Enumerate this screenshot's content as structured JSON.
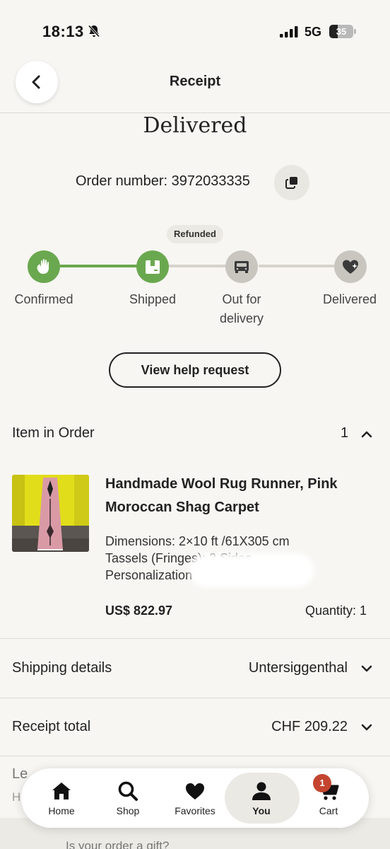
{
  "status_bar": {
    "time": "18:13",
    "network": "5G",
    "battery": "35",
    "battery_level": 0.35
  },
  "header": {
    "title": "Receipt",
    "back_icon": "chevron-left-icon"
  },
  "order": {
    "status_heading": "Delivered",
    "order_number_label": "Order number: 3972033335",
    "copy_icon": "copy-icon",
    "badge": "Refunded"
  },
  "tracker": {
    "steps": [
      {
        "label": "Confirmed",
        "icon": "hand-wave-icon",
        "done": true
      },
      {
        "label": "Shipped",
        "icon": "package-icon",
        "done": true
      },
      {
        "label": "Out for delivery",
        "icon": "truck-icon",
        "done": false
      },
      {
        "label": "Delivered",
        "icon": "heart-sparkle-icon",
        "done": false
      }
    ],
    "colors": {
      "done": "#6aa84f",
      "pending": "#d6d3cd",
      "pending_icon_bg": "#c9c6c0"
    }
  },
  "help_button": "View help request",
  "items_section": {
    "label": "Item in Order",
    "count": "1"
  },
  "product": {
    "title": "Handmade Wool Rug Runner, Pink Moroccan Shag Carpet",
    "dimensions": "Dimensions: 2×10 ft /61X305 cm",
    "tassels": "Tassels (Fringes): 2 Sides",
    "personalization": "Personalization",
    "price": "US$ 822.97",
    "quantity": "Quantity: 1"
  },
  "shipping": {
    "label": "Shipping details",
    "value": "Untersiggenthal"
  },
  "receipt_total": {
    "label": "Receipt total",
    "value": "CHF 209.22"
  },
  "partial": {
    "line1": "Le",
    "line2": "H",
    "gift": "Is your order a gift?"
  },
  "bottom_nav": {
    "items": [
      {
        "label": "Home",
        "icon": "home-icon"
      },
      {
        "label": "Shop",
        "icon": "search-icon"
      },
      {
        "label": "Favorites",
        "icon": "heart-icon"
      },
      {
        "label": "You",
        "icon": "person-icon",
        "active": true
      },
      {
        "label": "Cart",
        "icon": "cart-icon"
      }
    ],
    "cart_badge": "1",
    "badge_color": "#c4452f"
  }
}
